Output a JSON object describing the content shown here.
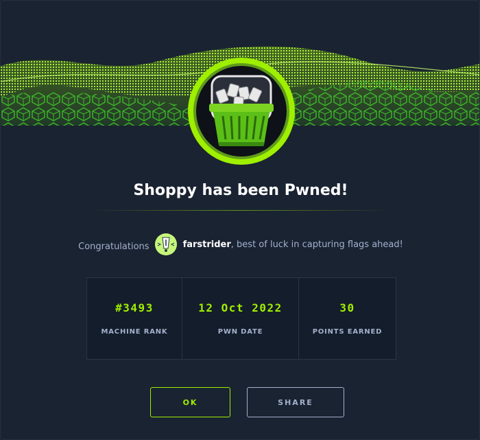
{
  "dialog": {
    "title": "Shoppy has been Pwned!",
    "congrats_prefix": "Congratulations",
    "username": "farstrider",
    "congrats_suffix": ", best of luck in capturing flags ahead!"
  },
  "stats": [
    {
      "value": "#3493",
      "label": "MACHINE RANK"
    },
    {
      "value": "12 Oct 2022",
      "label": "PWN DATE"
    },
    {
      "value": "30",
      "label": "POINTS EARNED"
    }
  ],
  "buttons": {
    "ok": "OK",
    "share": "SHARE"
  },
  "icons": {
    "badge": "shopping-basket-icon",
    "avatar": "user-avatar-icon",
    "banner": "green-cube-wave-banner"
  },
  "colors": {
    "background": "#1a2332",
    "accent": "#9fef00",
    "text_muted": "#a4b1cd",
    "title": "#ffffff",
    "avatar_bg": "#c5f57a"
  }
}
